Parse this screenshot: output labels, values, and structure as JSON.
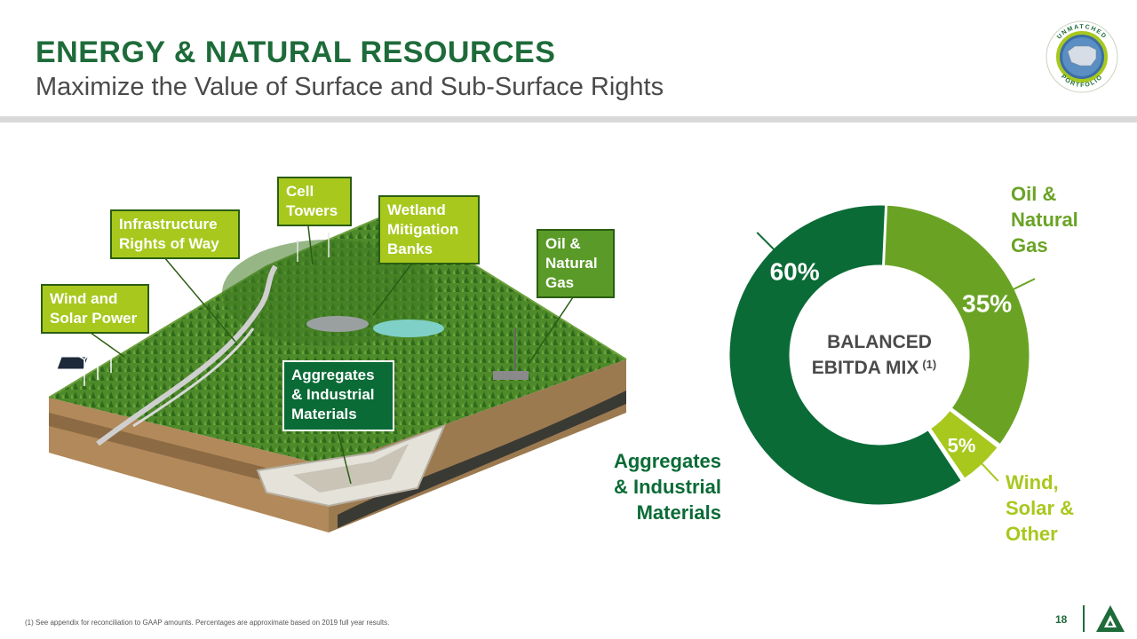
{
  "header": {
    "title": "ENERGY & NATURAL RESOURCES",
    "subtitle": "Maximize the Value of Surface and Sub-Surface Rights"
  },
  "badge": {
    "top_text": "UNMATCHED",
    "bottom_text": "PORTFOLIO"
  },
  "illustration": {
    "callouts": [
      {
        "id": "wind",
        "label_lines": [
          "Wind and",
          "Solar Power"
        ]
      },
      {
        "id": "infra",
        "label_lines": [
          "Infrastructure",
          "Rights of Way"
        ]
      },
      {
        "id": "cell",
        "label_lines": [
          "Cell",
          "Towers"
        ]
      },
      {
        "id": "wetland",
        "label_lines": [
          "Wetland",
          "Mitigation",
          "Banks"
        ]
      },
      {
        "id": "oil",
        "label_lines": [
          "Oil &",
          "Natural",
          "Gas"
        ]
      },
      {
        "id": "agg",
        "label_lines": [
          "Aggregates",
          "& Industrial",
          "Materials"
        ]
      }
    ]
  },
  "chart_data": {
    "type": "pie",
    "donut": true,
    "center_label_lines": [
      "BALANCED",
      "EBITDA MIX"
    ],
    "center_label_sup": "(1)",
    "slices": [
      {
        "label_lines": [
          "Oil &",
          "Natural",
          "Gas"
        ],
        "value": 35,
        "display": "35%",
        "color": "#6aa324"
      },
      {
        "label_lines": [
          "Wind,",
          "Solar &",
          "Other"
        ],
        "value": 5,
        "display": "5%",
        "color": "#a8c81e"
      },
      {
        "label_lines": [
          "Aggregates",
          "& Industrial",
          "Materials"
        ],
        "value": 60,
        "display": "60%",
        "color": "#0a6b36"
      }
    ]
  },
  "footer": {
    "footnote": "(1) See appendix for reconciliation to GAAP amounts. Percentages are approximate based on 2019 full year results.",
    "page_number": "18"
  },
  "colors": {
    "brand_green": "#1e6b3a",
    "lime": "#a8c81e",
    "mid_green": "#6aa324",
    "dark_green": "#0a6b36"
  }
}
